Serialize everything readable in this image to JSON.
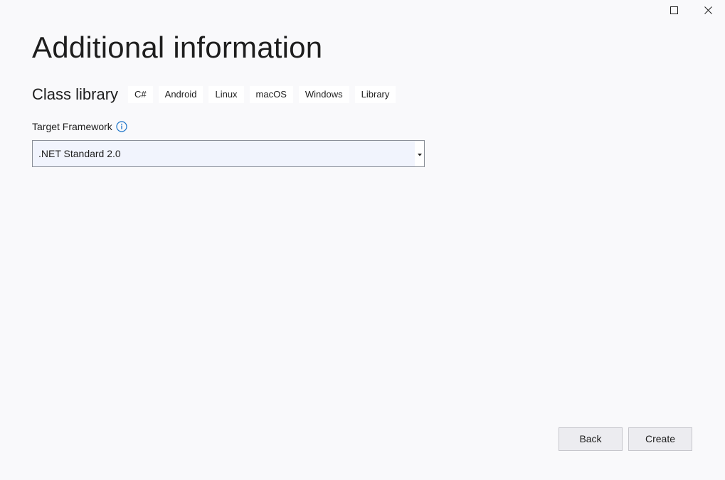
{
  "window": {
    "maximize_icon": "maximize-icon",
    "close_icon": "close-icon"
  },
  "page": {
    "title": "Additional information"
  },
  "template": {
    "name": "Class library",
    "tags": [
      "C#",
      "Android",
      "Linux",
      "macOS",
      "Windows",
      "Library"
    ]
  },
  "target_framework": {
    "label": "Target Framework",
    "info_icon": "info-icon",
    "selected": ".NET Standard 2.0"
  },
  "footer": {
    "back_label": "Back",
    "create_label": "Create"
  },
  "colors": {
    "background": "#f9f9fb",
    "select_background": "#f1f4fd",
    "info_icon": "#1a73c8",
    "button_background": "#ececf0"
  }
}
